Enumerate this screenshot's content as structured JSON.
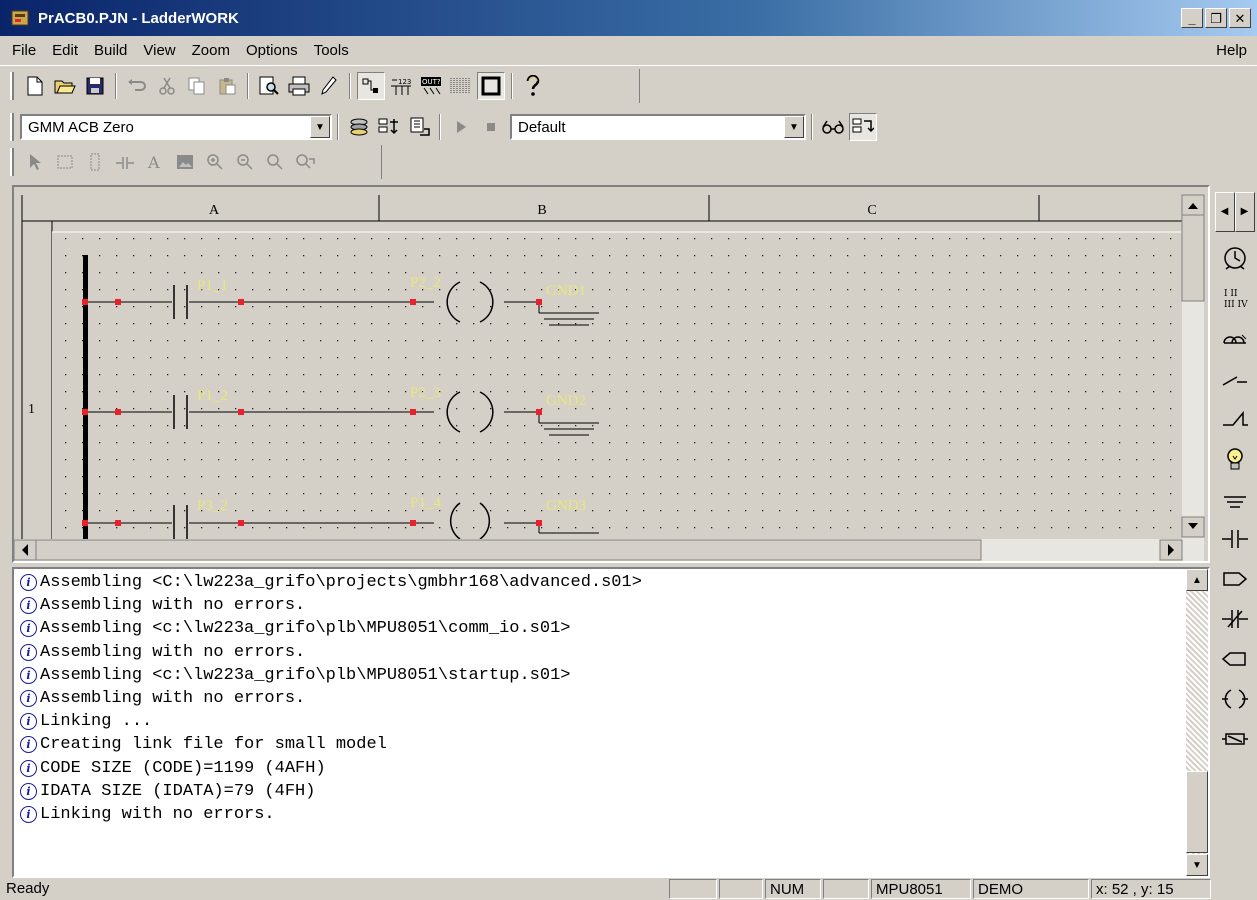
{
  "window": {
    "title": "PrACB0.PJN  - LadderWORK",
    "minimize": "_",
    "restore": "❐",
    "close": "✕"
  },
  "menu": {
    "items": [
      {
        "label": "File"
      },
      {
        "label": "Edit"
      },
      {
        "label": "Build"
      },
      {
        "label": "View"
      },
      {
        "label": "Zoom"
      },
      {
        "label": "Options"
      },
      {
        "label": "Tools"
      }
    ],
    "help": "Help"
  },
  "toolbar": {
    "target_combo": "GMM ACB Zero",
    "config_combo": "Default"
  },
  "ladder": {
    "columns": [
      "A",
      "B",
      "C"
    ],
    "rung_number": "1",
    "rungs": [
      {
        "contact": "P1_1",
        "coil": "P2_2",
        "ground": "GND1"
      },
      {
        "contact": "P1_2",
        "coil": "P2_3",
        "ground": "GND2"
      },
      {
        "contact": "P3_2",
        "coil": "P1_4",
        "ground": "GND3"
      }
    ]
  },
  "log": {
    "lines": [
      "Assembling <C:\\lw223a_grifo\\projects\\gmbhr168\\advanced.s01>",
      "Assembling with no errors.",
      "Assembling <c:\\lw223a_grifo\\plb\\MPU8051\\comm_io.s01>",
      "Assembling with no errors.",
      "Assembling <c:\\lw223a_grifo\\plb\\MPU8051\\startup.s01>",
      "Assembling with no errors.",
      "Linking ...",
      "Creating link file for small model",
      "CODE SIZE (CODE)=1199 (4AFH)",
      "IDATA SIZE (IDATA)=79 (4FH)",
      "Linking with no errors."
    ]
  },
  "status": {
    "text": "Ready",
    "num": "NUM",
    "cpu": "MPU8051",
    "mode": "DEMO",
    "coords": "x: 52 , y: 15"
  },
  "colors": {
    "title_start": "#0a246a",
    "title_end": "#a6caf0",
    "chrome": "#d4d0c8",
    "label_yellow": "#e8e87a",
    "wire_red": "#e8212a"
  }
}
